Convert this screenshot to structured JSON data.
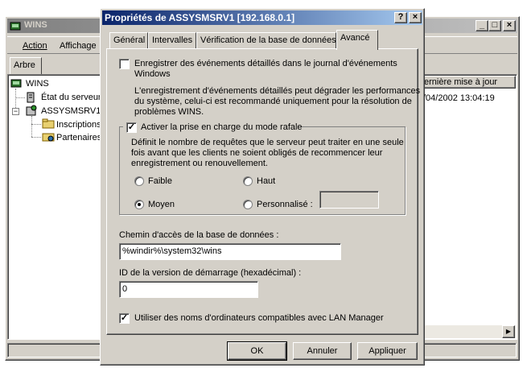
{
  "bg_window": {
    "title": "WINS",
    "menu": [
      "Action",
      "Affichage"
    ],
    "tree_tab": "Arbre",
    "tree": [
      "WINS",
      "État du serveur",
      "ASSYSMSRV1 [",
      "Inscriptions",
      "Partenaires"
    ],
    "column_header": "ernière mise à jour",
    "cell": "/04/2002 13:04:19"
  },
  "dialog": {
    "title": "Propriétés de ASSYSMSRV1 [192.168.0.1]",
    "help": "?",
    "close": "×",
    "tabs": [
      "Général",
      "Intervalles",
      "Vérification de la base de données",
      "Avancé"
    ],
    "log_checkbox": {
      "label_line1": "Enregistrer des événements détaillés dans le journal d'événements",
      "label_line2": "Windows",
      "checked": false
    },
    "log_warning": [
      "L'enregistrement d'événements détaillés peut dégrader les performances",
      "du système, celui-ci est recommandé uniquement pour la résolution de",
      "problèmes WINS."
    ],
    "burst": {
      "label": "Activer la prise en charge du mode rafale",
      "checked": true,
      "description": [
        "Définit le nombre de requêtes que le serveur peut traiter en une seule",
        "fois avant que les clients ne soient obligés de recommencer leur",
        "enregistrement ou renouvellement."
      ],
      "options": {
        "faible": "Faible",
        "haut": "Haut",
        "moyen": "Moyen",
        "perso": "Personnalisé :"
      },
      "selected": "Moyen",
      "custom_value": ""
    },
    "db_path_label": "Chemin d'accès de la base de données :",
    "db_path_value": "%windir%\\system32\\wins",
    "version_label": "ID de la version de démarrage (hexadécimal) :",
    "version_value": "0",
    "lanman": {
      "label": "Utiliser des noms d'ordinateurs compatibles avec LAN Manager",
      "checked": true
    },
    "buttons": {
      "ok": "OK",
      "cancel": "Annuler",
      "apply": "Appliquer"
    }
  },
  "colors": {
    "titlebar_active": "#0a246a",
    "titlebar_inactive": "#808080",
    "face": "#d4d0c8"
  }
}
